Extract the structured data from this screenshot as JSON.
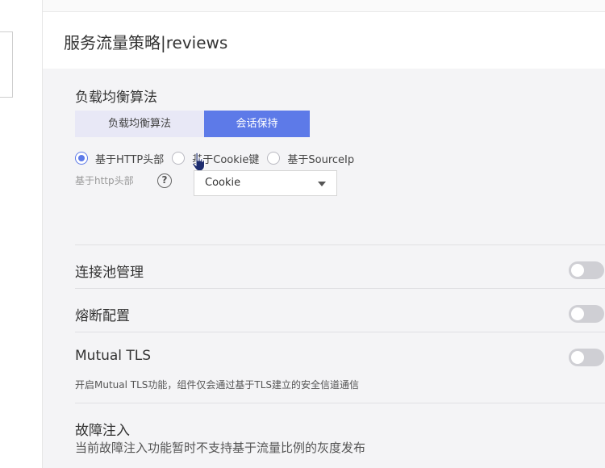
{
  "panel": {
    "title": "服务流量策略|reviews"
  },
  "load_balancing": {
    "title": "负载均衡算法",
    "tabs": [
      {
        "label": "负载均衡算法",
        "active": false
      },
      {
        "label": "会话保持",
        "active": true
      }
    ],
    "radio_options": [
      {
        "label": "基于HTTP头部",
        "checked": true
      },
      {
        "label": "基于Cookie键",
        "checked": false
      },
      {
        "label": "基于SourceIp",
        "checked": false
      }
    ],
    "http_header_label": "基于http头部",
    "help_symbol": "?",
    "select": {
      "value": "Cookie"
    }
  },
  "connection_pool": {
    "title": "连接池管理",
    "enabled": false
  },
  "circuit_breaker": {
    "title": "熔断配置",
    "enabled": false
  },
  "mutual_tls": {
    "title": "Mutual TLS",
    "enabled": false,
    "description": "开启Mutual TLS功能，组件仅会通过基于TLS建立的安全信道通信"
  },
  "fault_injection": {
    "title": "故障注入",
    "description": "当前故障注入功能暂时不支持基于流量比例的灰度发布"
  },
  "colors": {
    "accent": "#5d7ae8",
    "toggle_off": "#cfcfd4"
  }
}
